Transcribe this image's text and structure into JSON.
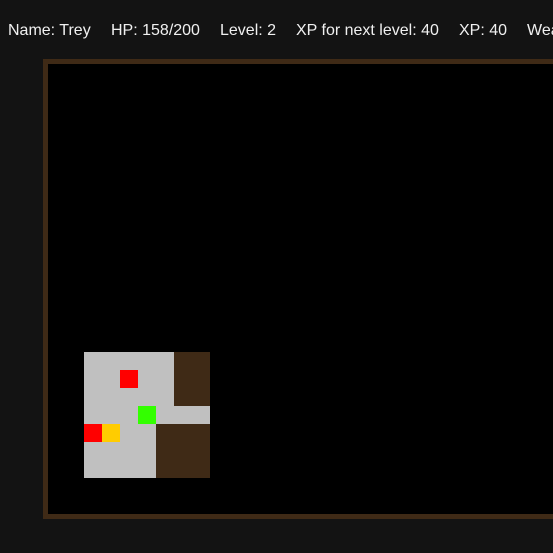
{
  "status": {
    "name": "Name: Trey",
    "hp": "HP: 158/200",
    "level": "Level: 2",
    "xp_next": "XP for next level: 40",
    "xp": "XP: 40",
    "weapon_partial": "Wea"
  },
  "colors": {
    "background": "#131313",
    "board_border": "#3f2a16",
    "board_fog": "#000000",
    "floor": "#c0c0c0",
    "wall": "#3f2a16",
    "player": "#33ff00",
    "enemy": "#ff0000",
    "item": "#ffcc00"
  },
  "legend": {
    "player": "player",
    "enemy": "enemy",
    "item": "item"
  }
}
